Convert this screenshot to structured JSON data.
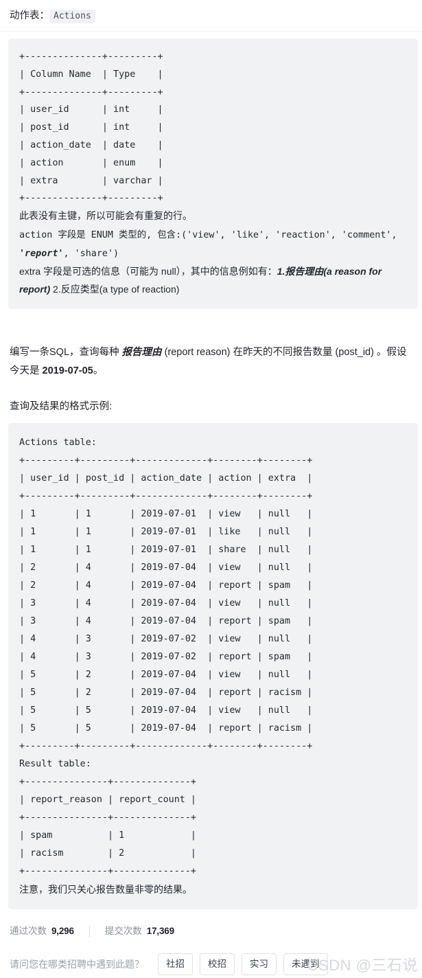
{
  "header": {
    "label": "动作表：",
    "table_name": "Actions"
  },
  "schema_block": {
    "lines": [
      "+--------------+---------+",
      "| Column Name  | Type    |",
      "+--------------+---------+",
      "| user_id      | int     |",
      "| post_id      | int     |",
      "| action_date  | date    |",
      "| action       | enum    |",
      "| extra        | varchar |",
      "+--------------+---------+"
    ],
    "notes": {
      "line1": "此表没有主键，所以可能会有重复的行。",
      "line2_pre": "action 字段是 ENUM 类型的, 包含:('view', 'like', 'reaction', 'comment', ",
      "line2_bold": "'report'",
      "line2_post": ", 'share')",
      "line3_pre": "extra 字段是可选的信息（可能为 null），其中的信息例如有：",
      "line3_bold": "1.报告理由(a reason for report)",
      "line3_post": " 2.反应类型(a type of reaction)"
    }
  },
  "prose": {
    "task_pre": "编写一条SQL，查询每种 ",
    "task_bold1": "报告理由",
    "task_mid": " (report reason) 在昨天的不同报告数量 (post_id) 。假设今天是 ",
    "task_bold2": "2019-07-05",
    "task_post": "。",
    "example_heading": "查询及结果的格式示例:"
  },
  "example_block": {
    "actions_caption": "Actions table:",
    "actions_table": {
      "headers": [
        "user_id",
        "post_id",
        "action_date",
        "action",
        "extra"
      ],
      "rows": [
        [
          "1",
          "1",
          "2019-07-01",
          "view",
          "null"
        ],
        [
          "1",
          "1",
          "2019-07-01",
          "like",
          "null"
        ],
        [
          "1",
          "1",
          "2019-07-01",
          "share",
          "null"
        ],
        [
          "2",
          "4",
          "2019-07-04",
          "view",
          "null"
        ],
        [
          "2",
          "4",
          "2019-07-04",
          "report",
          "spam"
        ],
        [
          "3",
          "4",
          "2019-07-04",
          "view",
          "null"
        ],
        [
          "3",
          "4",
          "2019-07-04",
          "report",
          "spam"
        ],
        [
          "4",
          "3",
          "2019-07-02",
          "view",
          "null"
        ],
        [
          "4",
          "3",
          "2019-07-02",
          "report",
          "spam"
        ],
        [
          "5",
          "2",
          "2019-07-04",
          "view",
          "null"
        ],
        [
          "5",
          "2",
          "2019-07-04",
          "report",
          "racism"
        ],
        [
          "5",
          "5",
          "2019-07-04",
          "view",
          "null"
        ],
        [
          "5",
          "5",
          "2019-07-04",
          "report",
          "racism"
        ]
      ],
      "ascii": [
        "Actions table:",
        "+---------+---------+-------------+--------+--------+",
        "| user_id | post_id | action_date | action | extra  |",
        "+---------+---------+-------------+--------+--------+",
        "| 1       | 1       | 2019-07-01  | view   | null   |",
        "| 1       | 1       | 2019-07-01  | like   | null   |",
        "| 1       | 1       | 2019-07-01  | share  | null   |",
        "| 2       | 4       | 2019-07-04  | view   | null   |",
        "| 2       | 4       | 2019-07-04  | report | spam   |",
        "| 3       | 4       | 2019-07-04  | view   | null   |",
        "| 3       | 4       | 2019-07-04  | report | spam   |",
        "| 4       | 3       | 2019-07-02  | view   | null   |",
        "| 4       | 3       | 2019-07-02  | report | spam   |",
        "| 5       | 2       | 2019-07-04  | view   | null   |",
        "| 5       | 2       | 2019-07-04  | report | racism |",
        "| 5       | 5       | 2019-07-04  | view   | null   |",
        "| 5       | 5       | 2019-07-04  | report | racism |",
        "+---------+---------+-------------+--------+--------+"
      ]
    },
    "result_caption": "Result table:",
    "result_table": {
      "headers": [
        "report_reason",
        "report_count"
      ],
      "rows": [
        [
          "spam",
          "1"
        ],
        [
          "racism",
          "2"
        ]
      ],
      "ascii": [
        "Result table:",
        "+---------------+--------------+",
        "| report_reason | report_count |",
        "+---------------+--------------+",
        "| spam          | 1            |",
        "| racism        | 2            |",
        "+---------------+--------------+"
      ]
    },
    "footnote": "注意，我们只关心报告数量非零的结果。"
  },
  "stats": {
    "pass_label": "通过次数",
    "pass_value": "9,296",
    "submit_label": "提交次数",
    "submit_value": "17,369"
  },
  "poll": {
    "question": "请问您在哪类招聘中遇到此题？",
    "options": [
      "社招",
      "校招",
      "实习",
      "未遇到"
    ]
  },
  "watermark": {
    "text": "CSDN @三石说"
  },
  "colors": {
    "code_background": "#f1f2f4",
    "text": "#1f2329",
    "muted": "#8a919a",
    "watermark": "#d6d9dd"
  }
}
